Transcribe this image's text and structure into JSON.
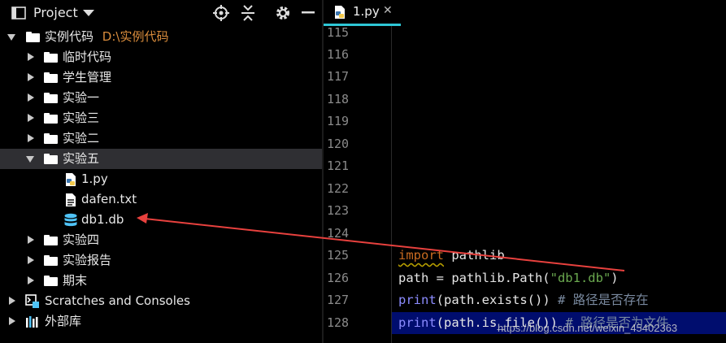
{
  "project_panel": {
    "title": "Project",
    "tree": {
      "root": {
        "name": "实例代码",
        "path": "D:\\实例代码"
      },
      "folders_before": [
        "临时代码",
        "学生管理",
        "实验一",
        "实验三",
        "实验二"
      ],
      "open_folder": "实验五",
      "files": [
        "1.py",
        "dafen.txt",
        "db1.db"
      ],
      "folders_after": [
        "实验四",
        "实验报告",
        "期末"
      ],
      "scratches": "Scratches and Consoles",
      "external_libs": "外部库"
    }
  },
  "editor": {
    "tab_label": "1.py",
    "line_numbers": [
      "115",
      "116",
      "117",
      "118",
      "119",
      "120",
      "121",
      "122",
      "123",
      "124",
      "125",
      "126",
      "127",
      "128"
    ],
    "code": {
      "line125": {
        "kw": "import",
        "rest": " pathlib"
      },
      "line126": {
        "a": "path = pathlib.Path(",
        "str": "\"db1.db\"",
        "b": ")"
      },
      "line127": {
        "fn": "print",
        "a": "(path.exists()) ",
        "comment": "# 路径是否存在"
      },
      "line128": {
        "fn": "print",
        "a": "(path.is_file()) ",
        "comment": "# 路径是否为文件"
      }
    }
  },
  "watermark": "https://blog.csdn.net/weixin_45402363",
  "colors": {
    "tab_underline": "#2ec7d6",
    "current_line": "#000d6e",
    "arrow": "#e8413e"
  }
}
